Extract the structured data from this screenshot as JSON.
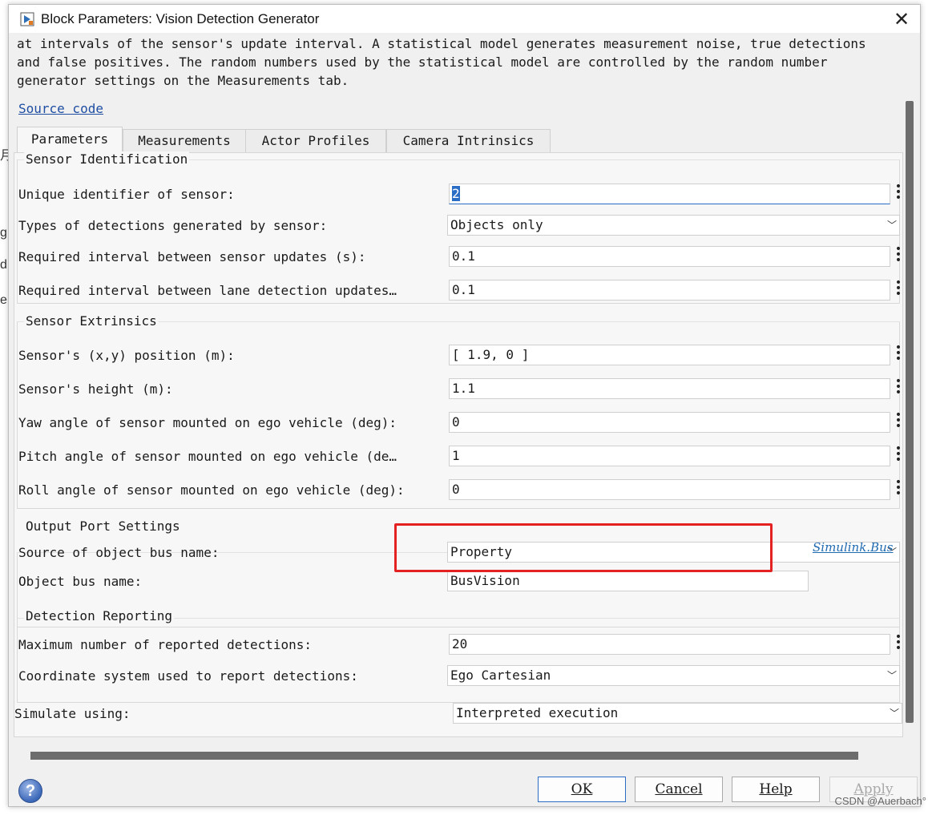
{
  "window": {
    "title": "Block Parameters: Vision Detection Generator",
    "close_symbol": "✕"
  },
  "description": {
    "lines": [
      "at intervals of the sensor's update interval. A statistical model generates measurement noise, true detections",
      "and false positives. The random numbers used by the statistical model are controlled by the random number",
      "generator settings on the Measurements tab."
    ],
    "source_link": "Source code"
  },
  "tabs": [
    {
      "label": "Parameters",
      "active": true
    },
    {
      "label": "Measurements",
      "active": false
    },
    {
      "label": "Actor Profiles",
      "active": false
    },
    {
      "label": "Camera Intrinsics",
      "active": false
    }
  ],
  "sensor_identification": {
    "title": "Sensor Identification",
    "unique_id_label": "Unique identifier of sensor:",
    "unique_id_value": "2",
    "detection_types_label": "Types of detections generated by sensor:",
    "detection_types_value": "Objects only",
    "update_interval_label": "Required interval between sensor updates (s):",
    "update_interval_value": "0.1",
    "lane_interval_label": "Required interval between lane detection updates…",
    "lane_interval_value": "0.1"
  },
  "sensor_extrinsics": {
    "title": "Sensor Extrinsics",
    "position_label": "Sensor's (x,y) position (m):",
    "position_value": "[ 1.9, 0 ]",
    "height_label": "Sensor's height (m):",
    "height_value": "1.1",
    "yaw_label": "Yaw angle of sensor mounted on ego vehicle (deg):",
    "yaw_value": "0",
    "pitch_label": "Pitch angle of sensor mounted on ego vehicle (de…",
    "pitch_value": "1",
    "roll_label": "Roll angle of sensor mounted on ego vehicle (deg):",
    "roll_value": "0"
  },
  "output_port": {
    "title": "Output Port Settings",
    "source_label": "Source of object bus name:",
    "source_value": "Property",
    "bus_name_label": "Object bus name:",
    "bus_name_value": "BusVision",
    "bus_link": "Simulink.Bus"
  },
  "detection_reporting": {
    "title": "Detection Reporting",
    "max_label": "Maximum number of reported detections:",
    "max_value": "20",
    "coord_label": "Coordinate system used to report detections:",
    "coord_value": "Ego Cartesian"
  },
  "simulate": {
    "label": "Simulate using:",
    "value": "Interpreted execution"
  },
  "buttons": {
    "ok": "OK",
    "cancel": "Cancel",
    "help": "Help",
    "apply": "Apply"
  },
  "help_icon_text": "?",
  "watermark": "CSDN @Auerbach°",
  "background_fragments": [
    "月",
    "g",
    "d",
    "e"
  ],
  "colors": {
    "highlight": "#e52222",
    "link": "#1f4ea3",
    "selection": "#2b6cc4"
  }
}
